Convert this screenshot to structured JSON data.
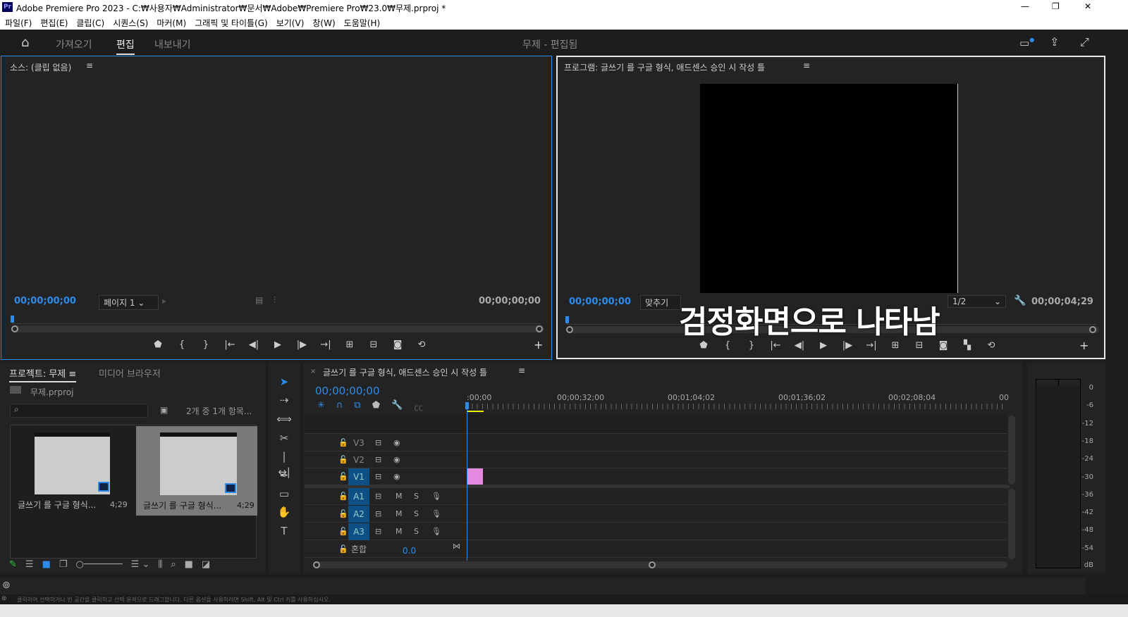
{
  "window": {
    "app_icon": "Pr",
    "title": "Adobe Premiere Pro 2023 - C:₩사용자₩Administrator₩문서₩Adobe₩Premiere Pro₩23.0₩무제.prproj *",
    "minimize": "—",
    "maximize": "❐",
    "close": "✕"
  },
  "menu": [
    "파일(F)",
    "편집(E)",
    "클립(C)",
    "시퀀스(S)",
    "마커(M)",
    "그래픽 및 타이틀(G)",
    "보기(V)",
    "창(W)",
    "도움말(H)"
  ],
  "workspace": {
    "tabs": [
      "가져오기",
      "편집",
      "내보내기"
    ],
    "active": "편집",
    "title": "무제 - 편집됨"
  },
  "source": {
    "title": "소스: (클립 없음)",
    "timecode_left": "00;00;00;00",
    "page": "페이지 1",
    "timecode_right": "00;00;00;00"
  },
  "program": {
    "title": "프로그램: 글쓰기 를 구글 형식, 애드센스 승인 시 작성 틀",
    "timecode_left": "00;00;00;00",
    "fit": "맞추기",
    "resolution": "1/2",
    "timecode_right": "00;00;04;29",
    "annotation": "검정화면으로 나타남"
  },
  "project": {
    "tabs": [
      "프로젝트: 무제",
      "미디어 브라우저"
    ],
    "file": "무제.prproj",
    "count": "2개 중 1개 항목...",
    "items": [
      {
        "name": "글쓰기 를 구글 형식...",
        "duration": "4;29"
      },
      {
        "name": "글쓰기 를 구글 형식...",
        "duration": "4;29"
      }
    ]
  },
  "timeline": {
    "title": "글쓰기 를 구글 형식, 애드센스 승인 시 작성 틀",
    "timecode": "00;00;00;00",
    "ruler": [
      ":00;00",
      "00;00;32;00",
      "00;01;04;02",
      "00;01;36;02",
      "00;02;08;04",
      "00"
    ],
    "video_tracks": [
      "V3",
      "V2",
      "V1"
    ],
    "audio_tracks": [
      "A1",
      "A2",
      "A3"
    ],
    "mix_label": "혼합",
    "mix_value": "0.0",
    "clip_color": "#e58ae0"
  },
  "meter": {
    "scale": [
      "0",
      "-6",
      "-12",
      "-18",
      "-24",
      "-30",
      "-36",
      "-42",
      "-48",
      "-54",
      "dB"
    ]
  },
  "status": "클릭하여 선택하거나 빈 공간을 클릭하고 선택 윤곽으로 드래그합니다. 다른 옵션을 사용하려면 Shift, Alt 및 Ctrl 키를 사용하십시오."
}
